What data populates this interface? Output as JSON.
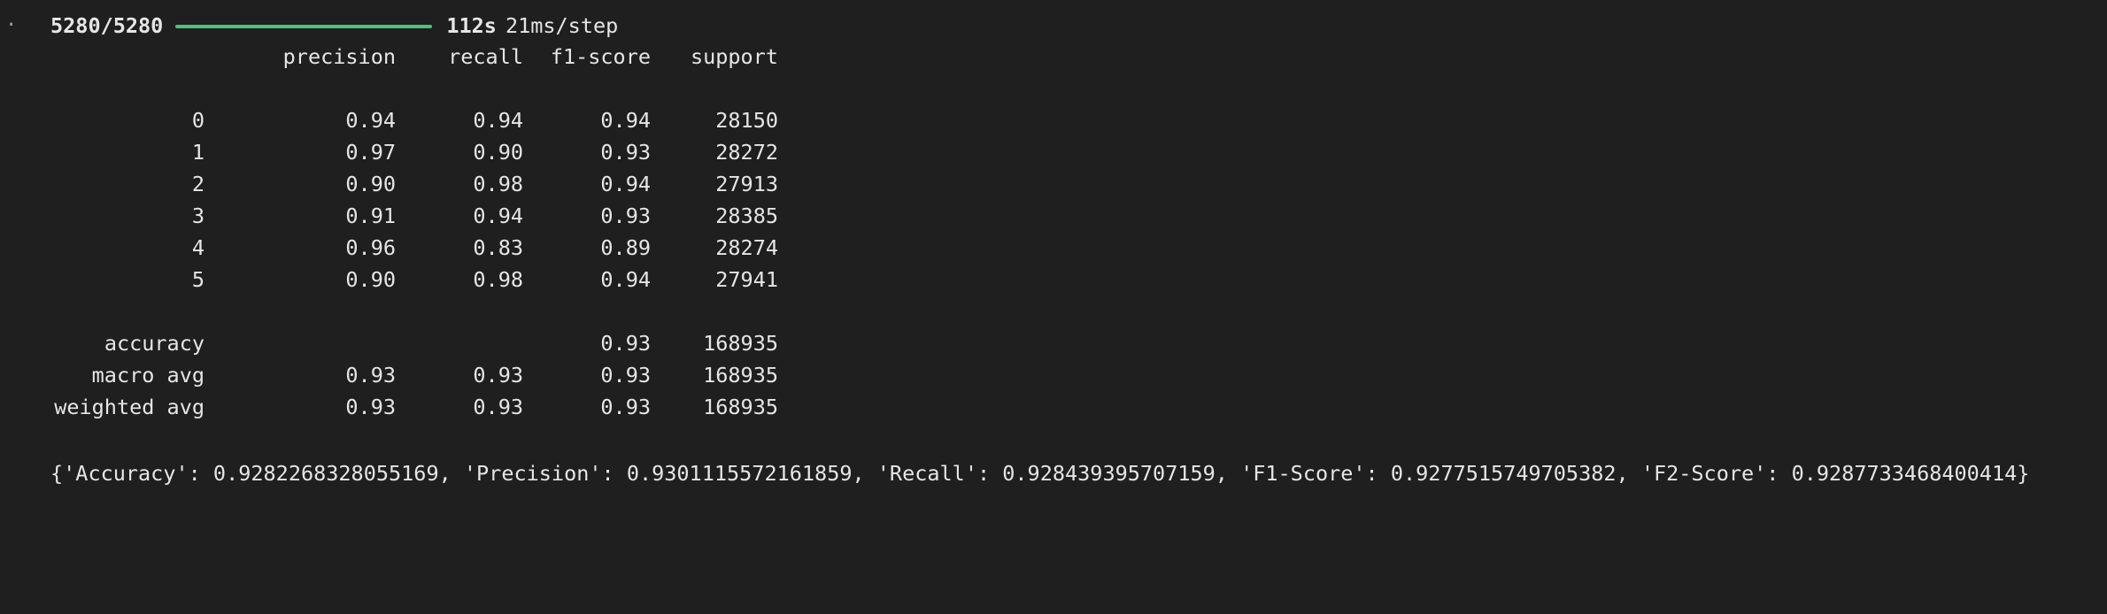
{
  "progress": {
    "counter": "5280/5280",
    "fraction": 1.0,
    "bar_color": "#4fbf7f",
    "elapsed": "112s",
    "step_time": "21ms/step"
  },
  "report": {
    "headers": {
      "precision": "precision",
      "recall": "recall",
      "f1": "f1-score",
      "support": "support"
    },
    "classes": [
      {
        "label": "0",
        "precision": "0.94",
        "recall": "0.94",
        "f1": "0.94",
        "support": "28150"
      },
      {
        "label": "1",
        "precision": "0.97",
        "recall": "0.90",
        "f1": "0.93",
        "support": "28272"
      },
      {
        "label": "2",
        "precision": "0.90",
        "recall": "0.98",
        "f1": "0.94",
        "support": "27913"
      },
      {
        "label": "3",
        "precision": "0.91",
        "recall": "0.94",
        "f1": "0.93",
        "support": "28385"
      },
      {
        "label": "4",
        "precision": "0.96",
        "recall": "0.83",
        "f1": "0.89",
        "support": "28274"
      },
      {
        "label": "5",
        "precision": "0.90",
        "recall": "0.98",
        "f1": "0.94",
        "support": "27941"
      }
    ],
    "accuracy": {
      "label": "accuracy",
      "f1": "0.93",
      "support": "168935"
    },
    "macro_avg": {
      "label": "macro avg",
      "precision": "0.93",
      "recall": "0.93",
      "f1": "0.93",
      "support": "168935"
    },
    "weighted_avg": {
      "label": "weighted avg",
      "precision": "0.93",
      "recall": "0.93",
      "f1": "0.93",
      "support": "168935"
    }
  },
  "metrics_dict": "{'Accuracy': 0.9282268328055169, 'Precision': 0.9301115572161859, 'Recall': 0.928439395707159, 'F1-Score': 0.9277515749705382, 'F2-Score': 0.9287733468400414}",
  "gutter_marker": "·"
}
